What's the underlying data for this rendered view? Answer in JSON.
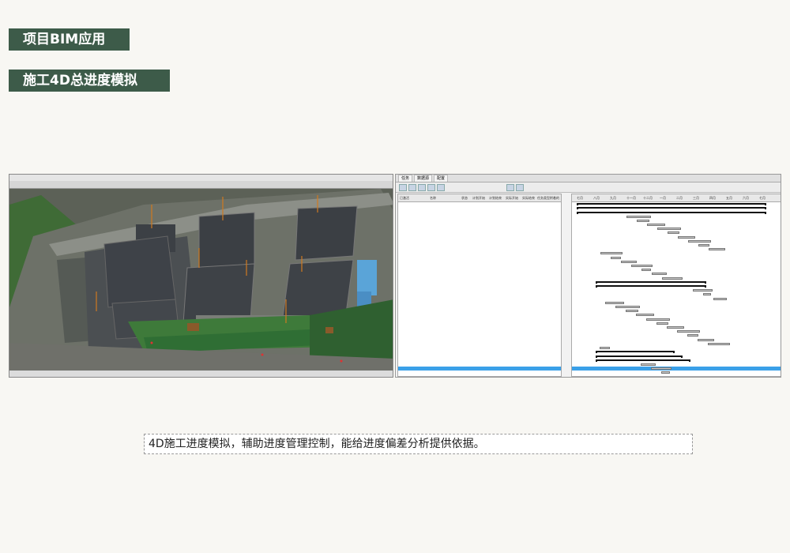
{
  "header": {
    "title": "项目BIM应用",
    "subtitle": "施工4D总进度模拟"
  },
  "caption": "4D施工进度模拟，辅助进度管理控制，能给进度偏差分析提供依据。",
  "colors": {
    "header_bg": "#3d5b49",
    "selected_row": "#3aa0e8",
    "status_text": "#2244bb"
  },
  "schedule": {
    "tabs": [
      "任务",
      "数据源",
      "配置"
    ],
    "table_columns": [
      "已激活",
      "名称",
      "状态",
      "计划开始",
      "计划结束",
      "实际开始",
      "实际结束",
      "任务类型",
      "附着的"
    ],
    "gantt_months": [
      "七月",
      "八月",
      "九月",
      "十一月",
      "十二月",
      "一月",
      "二月",
      "三月",
      "四月",
      "五月",
      "六月",
      "七月"
    ],
    "bar_rows": 42
  }
}
